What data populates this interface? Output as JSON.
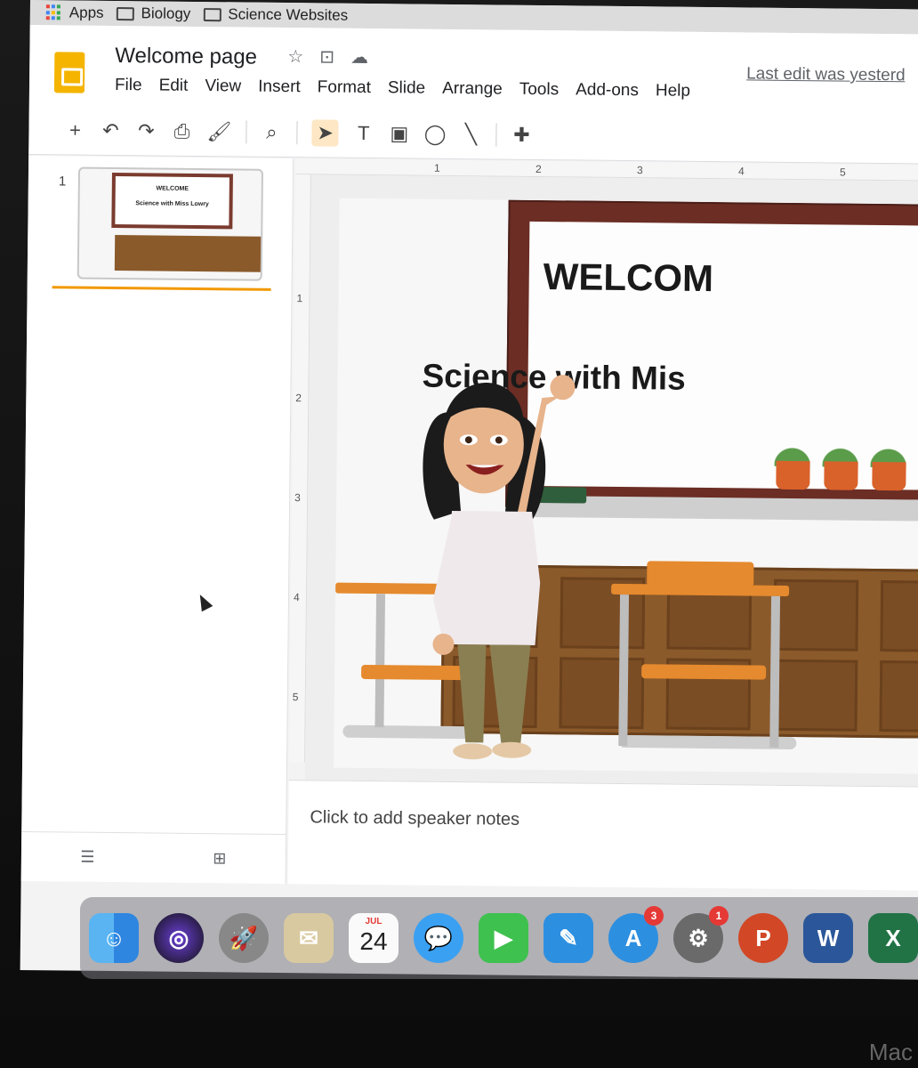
{
  "bookmarks": [
    {
      "label": "Apps",
      "icon": "apps-grid-icon"
    },
    {
      "label": "Biology",
      "icon": "folder-icon"
    },
    {
      "label": "Science Websites",
      "icon": "folder-icon"
    }
  ],
  "header": {
    "doc_title": "Welcome page",
    "last_edit": "Last edit was yesterd",
    "menu": [
      "File",
      "Edit",
      "View",
      "Insert",
      "Format",
      "Slide",
      "Arrange",
      "Tools",
      "Add-ons",
      "Help"
    ]
  },
  "toolbar": {
    "new": "+",
    "undo": "↶",
    "redo": "↷",
    "print": "⎙",
    "paint": "🖌",
    "zoom": "⌕",
    "select": "➤",
    "textbox": "T",
    "image": "▣",
    "shape": "◯",
    "line": "╲",
    "comment": "✚"
  },
  "filmstrip": {
    "slide_number": "1",
    "thumb_title": "WELCOME",
    "thumb_subtitle": "Science with Miss Lowry"
  },
  "ruler": {
    "top": [
      "1",
      "2",
      "3",
      "4",
      "5"
    ],
    "left": [
      "1",
      "2",
      "3",
      "4",
      "5"
    ]
  },
  "slide": {
    "title": "WELCOM",
    "subtitle": "Science with Mis"
  },
  "notes": {
    "placeholder": "Click to add speaker notes"
  },
  "dock": {
    "calendar_month": "JUL",
    "calendar_day": "24",
    "appstore_badge": "3",
    "prefs_badge": "1",
    "powerpoint": "P",
    "word": "W",
    "excel": "X"
  },
  "device_label": "Mac",
  "colors": {
    "slides_brand": "#f4b400",
    "accent_orange": "#f29900",
    "board_frame": "#6b2d24",
    "badge_red": "#e53935"
  }
}
